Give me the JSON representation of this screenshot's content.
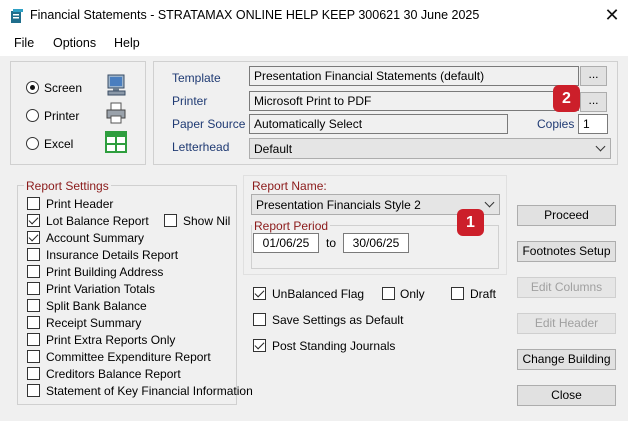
{
  "window": {
    "title": "Financial Statements - STRATAMAX ONLINE HELP KEEP 300621 30 June 2025"
  },
  "menu": [
    "File",
    "Options",
    "Help"
  ],
  "output": {
    "options": [
      {
        "label": "Screen",
        "selected": true,
        "icon": "monitor-icon"
      },
      {
        "label": "Printer",
        "selected": false,
        "icon": "printer-icon"
      },
      {
        "label": "Excel",
        "selected": false,
        "icon": "spreadsheet-icon"
      }
    ]
  },
  "print_settings": {
    "template_label": "Template",
    "template_value": "Presentation Financial Statements (default)",
    "printer_label": "Printer",
    "printer_value": "Microsoft Print to PDF",
    "paper_source_label": "Paper Source",
    "paper_source_value": "Automatically Select",
    "copies_label": "Copies",
    "copies_value": "1",
    "letterhead_label": "Letterhead",
    "letterhead_value": "Default",
    "browse_label": "..."
  },
  "report_settings": {
    "legend": "Report Settings",
    "items": [
      {
        "label": "Print Header",
        "checked": false
      },
      {
        "label": "Lot Balance Report",
        "checked": true
      },
      {
        "label": "Account Summary",
        "checked": true
      },
      {
        "label": "Insurance Details Report",
        "checked": false
      },
      {
        "label": "Print Building Address",
        "checked": false
      },
      {
        "label": "Print Variation Totals",
        "checked": false
      },
      {
        "label": "Split Bank Balance",
        "checked": false
      },
      {
        "label": "Receipt Summary",
        "checked": false
      },
      {
        "label": "Print Extra Reports Only",
        "checked": false
      },
      {
        "label": "Committee Expenditure Report",
        "checked": false
      },
      {
        "label": "Creditors Balance Report",
        "checked": false
      },
      {
        "label": "Statement of Key Financial Information",
        "checked": false
      }
    ],
    "show_nil": {
      "label": "Show Nil",
      "checked": false
    }
  },
  "report": {
    "name_label": "Report Name:",
    "name_value": "Presentation Financials Style 2",
    "period_label": "Report Period",
    "from": "01/06/25",
    "to_label": "to",
    "to": "30/06/25"
  },
  "flags": {
    "unbalanced": {
      "label": "UnBalanced Flag",
      "checked": true
    },
    "only": {
      "label": "Only",
      "checked": false
    },
    "draft": {
      "label": "Draft",
      "checked": false
    },
    "save_default": {
      "label": "Save Settings as Default",
      "checked": false
    },
    "post_standing": {
      "label": "Post Standing Journals",
      "checked": true
    }
  },
  "buttons": {
    "proceed": "Proceed",
    "footnotes": "Footnotes Setup",
    "edit_columns": "Edit Columns",
    "edit_header": "Edit Header",
    "change_building": "Change Building",
    "close": "Close"
  },
  "badges": {
    "one": "1",
    "two": "2"
  },
  "colors": {
    "badge": "#cc1f2a",
    "group_label_red": "#8b1a1a",
    "field_label_blue": "#1f3a73"
  }
}
